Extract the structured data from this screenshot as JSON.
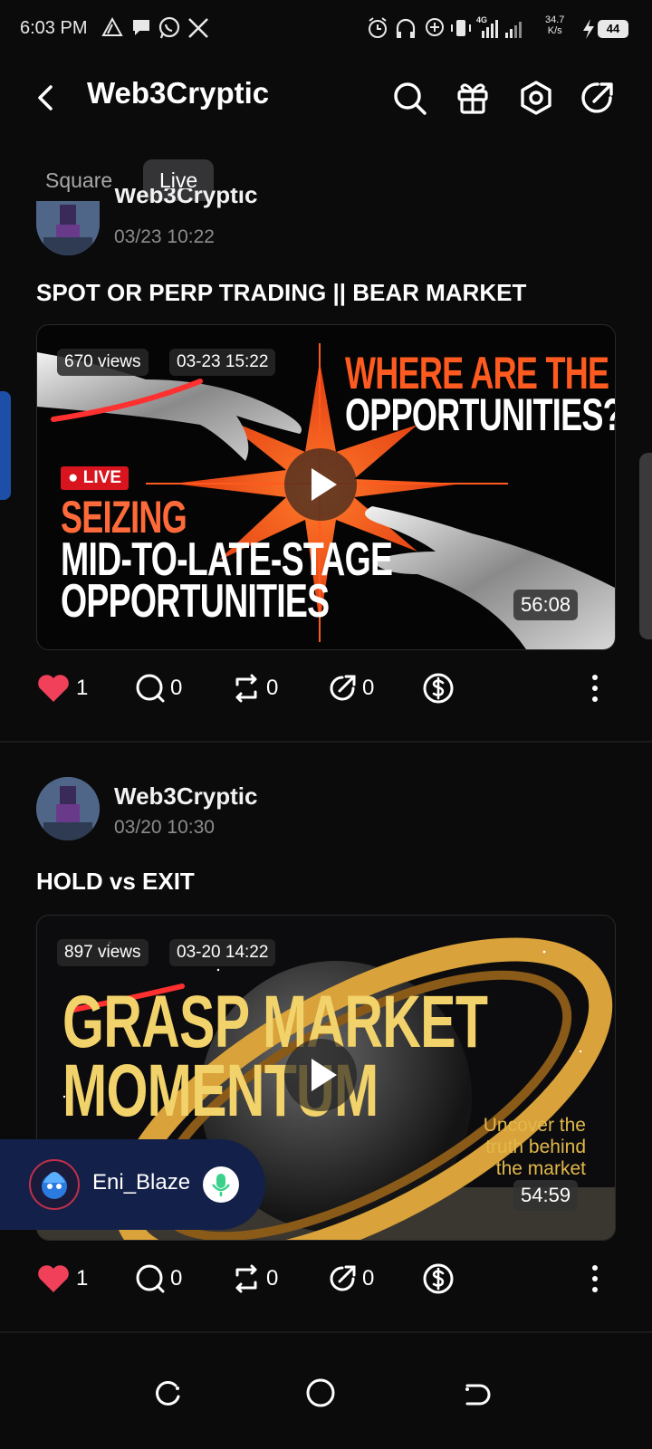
{
  "status_bar": {
    "time": "6:03 PM",
    "net_speed_value": "34.7",
    "net_speed_unit": "K/s",
    "battery": "44"
  },
  "header": {
    "title": "Web3Cryptic",
    "icons": [
      "back-arrow-icon",
      "search-icon",
      "gift-icon",
      "settings-icon",
      "share-icon"
    ]
  },
  "tabs": [
    {
      "label": "Square",
      "active": false
    },
    {
      "label": "Live",
      "active": true
    }
  ],
  "posts": [
    {
      "author": "Web3Cryptic",
      "timestamp": "03/23 10:22",
      "title": "SPOT OR PERP TRADING || BEAR MARKET",
      "video": {
        "views": "670 views",
        "date": "03-23 15:22",
        "duration": "56:08",
        "badge": "LIVE",
        "headline_1": "WHERE ARE THE",
        "headline_2": "OPPORTUNITIES?",
        "caption_1": "SEIZING",
        "caption_2": "MID-TO-LATE-STAGE",
        "caption_3": "OPPORTUNITIES"
      },
      "actions": {
        "likes": "1",
        "comments": "0",
        "reposts": "0",
        "shares": "0"
      }
    },
    {
      "author": "Web3Cryptic",
      "timestamp": "03/20 10:30",
      "title": "HOLD vs EXIT",
      "video": {
        "views": "897 views",
        "date": "03-20 14:22",
        "duration": "54:59",
        "headline_1": "GRASP MARKET",
        "headline_2": "MOMENTUM",
        "tagline_1": "Uncover the",
        "tagline_2": "truth behind",
        "tagline_3": "the market"
      },
      "actions": {
        "likes": "1",
        "comments": "0",
        "reposts": "0",
        "shares": "0"
      }
    }
  ],
  "floating_live": {
    "user": "Eni_Blaze"
  },
  "colors": {
    "background": "#0b0b0c",
    "like": "#f0405a",
    "live_red": "#d8141e",
    "accent_orange": "#ff5a1f",
    "accent_gold": "#f2c94c",
    "floater_bg": "#13204a",
    "mic_green": "#3bd18a"
  }
}
